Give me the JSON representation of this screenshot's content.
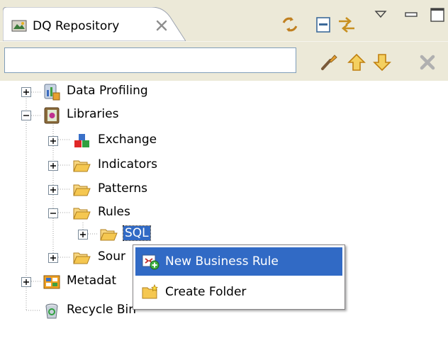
{
  "view": {
    "tab_title": "DQ Repository",
    "filter": {
      "value": "",
      "placeholder": ""
    }
  },
  "tree": {
    "data_profiling": "Data Profiling",
    "libraries": "Libraries",
    "exchange": "Exchange",
    "indicators": "Indicators",
    "patterns": "Patterns",
    "rules": "Rules",
    "sql": "SQL",
    "source_files": "Sour",
    "metadata": "Metadat",
    "recycle_bin": "Recycle Bin"
  },
  "context_menu": {
    "items": [
      {
        "label": "New Business Rule",
        "icon": "new-business-rule-icon",
        "highlighted": true
      },
      {
        "label": "Create Folder",
        "icon": "create-folder-icon",
        "highlighted": false
      }
    ]
  },
  "colors": {
    "selection": "#316ac5",
    "toolbar_bg": "#ece9d8",
    "folder": "#f5c750"
  }
}
